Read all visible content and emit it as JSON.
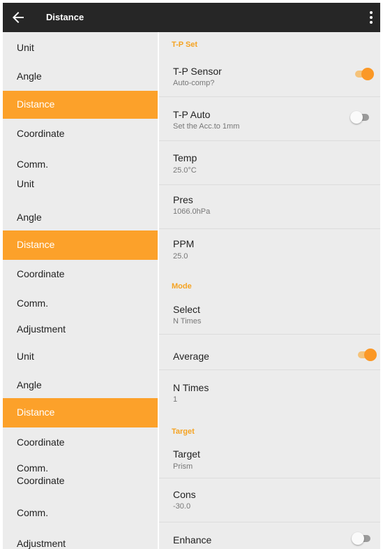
{
  "appbar": {
    "title": "Distance",
    "back_icon": "arrow-left-icon",
    "menu_icon": "more-vert-icon"
  },
  "left": {
    "group1": [
      "Unit",
      "Angle",
      "Distance",
      "Coordinate",
      "Comm."
    ],
    "group2": [
      "Unit",
      "Angle",
      "Distance",
      "Coordinate",
      "Comm.",
      "Adjustment"
    ],
    "group3": [
      "Unit",
      "Angle",
      "Distance",
      "Coordinate",
      "Comm.",
      "Coordinate",
      "Comm.",
      "Adjustment"
    ]
  },
  "settings": {
    "tp_set": "T-P Set",
    "tp_sensor": {
      "title": "T-P Sensor",
      "subtitle": "Auto-comp?",
      "on": true
    },
    "tp_auto": {
      "title": "T-P Auto",
      "subtitle": "Set the Acc.to 1mm",
      "on": false
    },
    "temp": {
      "title": "Temp",
      "value": "25.0°C"
    },
    "pres": {
      "title": "Pres",
      "value": "1066.0hPa"
    },
    "ppm": {
      "title": "PPM",
      "value": "25.0"
    },
    "mode": "Mode",
    "select": {
      "title": "Select",
      "value": "N Times"
    },
    "average": {
      "title": "Average",
      "on": true
    },
    "n_times": {
      "title": "N Times",
      "value": "1"
    },
    "target_section": "Target",
    "target": {
      "title": "Target",
      "value": "Prism"
    },
    "cons": {
      "title": "Cons",
      "value": "-30.0"
    },
    "enhance": {
      "title": "Enhance",
      "on": false
    }
  },
  "colors": {
    "accent": "#fca12a",
    "appbar": "#262626",
    "background": "#ececec"
  }
}
